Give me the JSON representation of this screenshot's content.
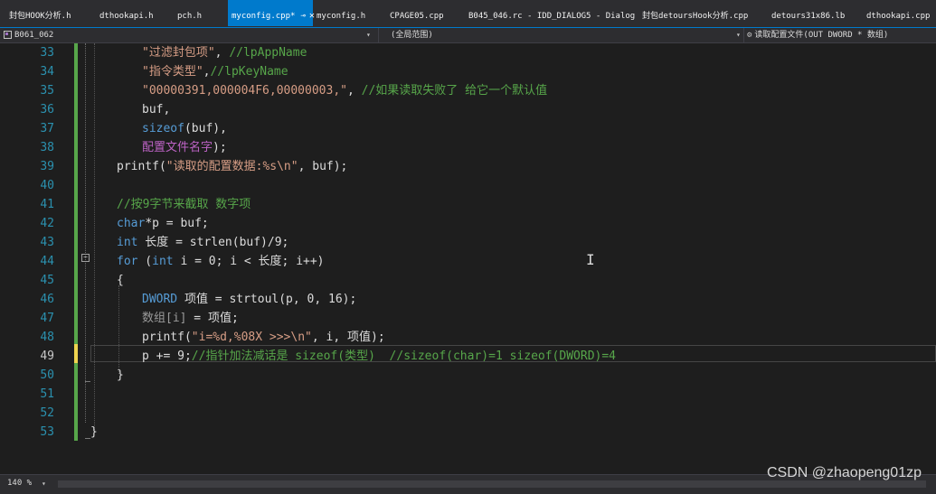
{
  "tabs": [
    {
      "label": "封包HOOK分析.h",
      "active": false
    },
    {
      "label": "dthookapi.h",
      "active": false
    },
    {
      "label": "pch.h",
      "active": false
    },
    {
      "label": "myconfig.cpp*",
      "active": true
    },
    {
      "label": "myconfig.h",
      "active": false
    },
    {
      "label": "CPAGE05.cpp",
      "active": false
    },
    {
      "label": "B045_046.rc - IDD_DIALOG5 - Dialog",
      "active": false
    },
    {
      "label": "封包detoursHook分析.cpp",
      "active": false
    },
    {
      "label": "detours31x86.lb",
      "active": false
    },
    {
      "label": "dthookapi.cpp",
      "active": false
    }
  ],
  "active_tab_icons": {
    "pin": "⊸",
    "close": "✕"
  },
  "navbar": {
    "project": "B061_062",
    "scope": "(全局范围)",
    "function": "读取配置文件(OUT DWORD * 数组)",
    "dropdown_arrow": "▾"
  },
  "editor": {
    "current_line": 49,
    "lines": [
      {
        "num": 33,
        "tokens": [
          {
            "t": "\"过滤封包项\"",
            "c": "str"
          },
          {
            "t": ", ",
            "c": "plain"
          },
          {
            "t": "//lpAppName",
            "c": "comment"
          }
        ]
      },
      {
        "num": 34,
        "tokens": [
          {
            "t": "\"指令类型\"",
            "c": "str"
          },
          {
            "t": ",",
            "c": "plain"
          },
          {
            "t": "//lpKeyName",
            "c": "comment"
          }
        ]
      },
      {
        "num": 35,
        "tokens": [
          {
            "t": "\"00000391,000004F6,00000003,\"",
            "c": "str"
          },
          {
            "t": ", ",
            "c": "plain"
          },
          {
            "t": "//如果读取失败了 给它一个默认值",
            "c": "comment"
          }
        ]
      },
      {
        "num": 36,
        "tokens": [
          {
            "t": "buf,",
            "c": "plain"
          }
        ]
      },
      {
        "num": 37,
        "tokens": [
          {
            "t": "sizeof",
            "c": "keyword"
          },
          {
            "t": "(buf),",
            "c": "plain"
          }
        ]
      },
      {
        "num": 38,
        "tokens": [
          {
            "t": "配置文件名字",
            "c": "macro"
          },
          {
            "t": ");",
            "c": "plain"
          }
        ]
      },
      {
        "num": 39,
        "tokens": [
          {
            "t": "printf(",
            "c": "plain"
          },
          {
            "t": "\"读取的配置数据:%s\\n\"",
            "c": "str"
          },
          {
            "t": ", buf);",
            "c": "plain"
          }
        ]
      },
      {
        "num": 40,
        "tokens": []
      },
      {
        "num": 41,
        "tokens": [
          {
            "t": "//按9字节来截取 数字项",
            "c": "comment"
          }
        ]
      },
      {
        "num": 42,
        "tokens": [
          {
            "t": "char",
            "c": "keyword"
          },
          {
            "t": "*p = buf;",
            "c": "plain"
          }
        ]
      },
      {
        "num": 43,
        "tokens": [
          {
            "t": "int",
            "c": "keyword"
          },
          {
            "t": " 长度 = strlen(buf)/9;",
            "c": "plain"
          }
        ]
      },
      {
        "num": 44,
        "tokens": [
          {
            "t": "for",
            "c": "keyword"
          },
          {
            "t": " (",
            "c": "plain"
          },
          {
            "t": "int",
            "c": "keyword"
          },
          {
            "t": " i = 0; i < 长度; i++)",
            "c": "plain"
          }
        ]
      },
      {
        "num": 45,
        "tokens": [
          {
            "t": "{",
            "c": "plain"
          }
        ]
      },
      {
        "num": 46,
        "tokens": [
          {
            "t": "DWORD",
            "c": "keyword"
          },
          {
            "t": " 项值 = strtoul(p, 0, 16);",
            "c": "plain"
          }
        ]
      },
      {
        "num": 47,
        "tokens": [
          {
            "t": "数组[i]",
            "c": "param"
          },
          {
            "t": " = 项值;",
            "c": "plain"
          }
        ]
      },
      {
        "num": 48,
        "tokens": [
          {
            "t": "printf(",
            "c": "plain"
          },
          {
            "t": "\"i=%d,%08X >>>\\n\"",
            "c": "str"
          },
          {
            "t": ", i, 项值);",
            "c": "plain"
          }
        ]
      },
      {
        "num": 49,
        "tokens": [
          {
            "t": "p += 9;",
            "c": "plain"
          },
          {
            "t": "//指针加法减话是 sizeof(类型)  //sizeof(char)=1 sizeof(DWORD)=4",
            "c": "comment"
          }
        ]
      },
      {
        "num": 50,
        "tokens": [
          {
            "t": "}",
            "c": "plain"
          }
        ]
      },
      {
        "num": 51,
        "tokens": []
      },
      {
        "num": 52,
        "tokens": []
      },
      {
        "num": 53,
        "tokens": [
          {
            "t": "}",
            "c": "plain"
          }
        ]
      }
    ]
  },
  "syntax_colors": {
    "plain": "#dcdcdc",
    "str": "#d69d85",
    "comment": "#57a64a",
    "keyword": "#569cd6",
    "macro": "#bd63c5",
    "param": "#9a9a9a",
    "line_number": "#2b91af",
    "change_bar": "#57a64a",
    "unsaved_bar": "#efd44f",
    "tab_active": "#007acc"
  },
  "statusbar": {
    "zoom": "140 %",
    "zoom_arrow": "▾"
  },
  "watermark": "CSDN @zhaopeng01zp"
}
